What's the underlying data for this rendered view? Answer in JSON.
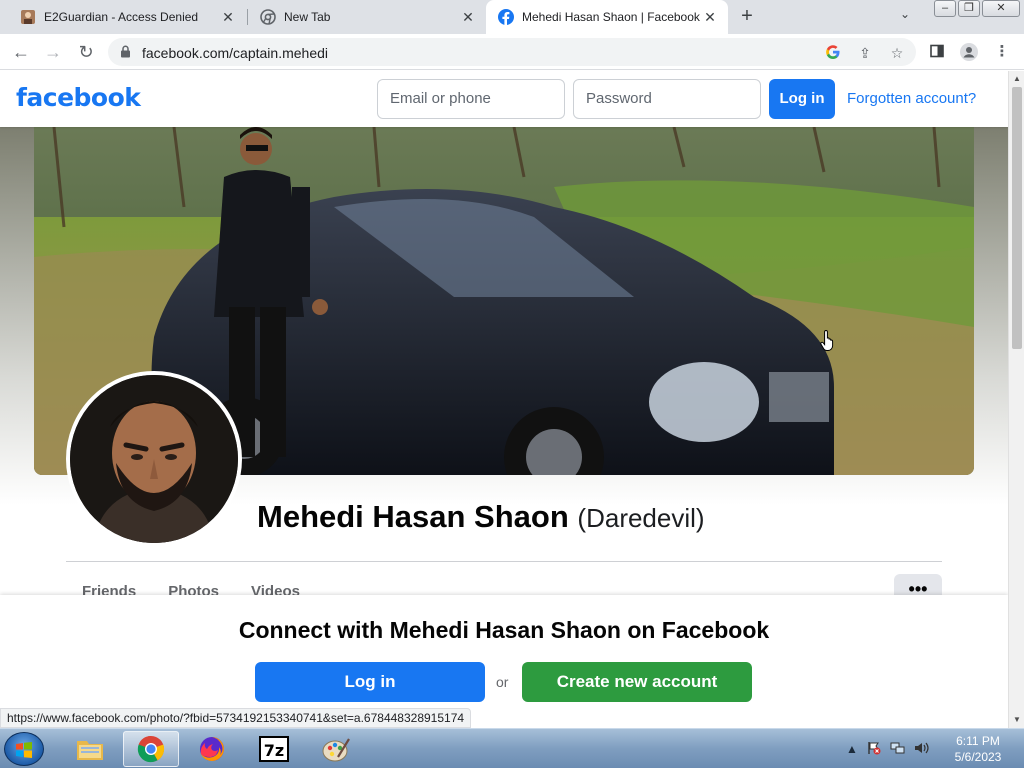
{
  "browser": {
    "tabs": [
      {
        "title": "E2Guardian - Access Denied",
        "active": false
      },
      {
        "title": "New Tab",
        "active": false
      },
      {
        "title": "Mehedi Hasan Shaon | Facebook",
        "active": true
      }
    ],
    "url": "facebook.com/captain.mehedi",
    "status_url": "https://www.facebook.com/photo/?fbid=5734192153340741&set=a.678448328915174"
  },
  "header": {
    "logo": "facebook",
    "email_placeholder": "Email or phone",
    "password_placeholder": "Password",
    "login_label": "Log in",
    "forgot_label": "Forgotten account?"
  },
  "profile": {
    "name": "Mehedi Hasan Shaon",
    "alternate_name": "(Daredevil)",
    "tabs": [
      "Friends",
      "Photos",
      "Videos"
    ],
    "more_label": "•••"
  },
  "connect": {
    "title": "Connect with Mehedi Hasan Shaon on Facebook",
    "login_label": "Log in",
    "or_label": "or",
    "create_label": "Create new account"
  },
  "taskbar": {
    "time": "6:11 PM",
    "date": "5/6/2023"
  },
  "colors": {
    "facebook_blue": "#1877f2",
    "create_green": "#2d9b3f"
  }
}
